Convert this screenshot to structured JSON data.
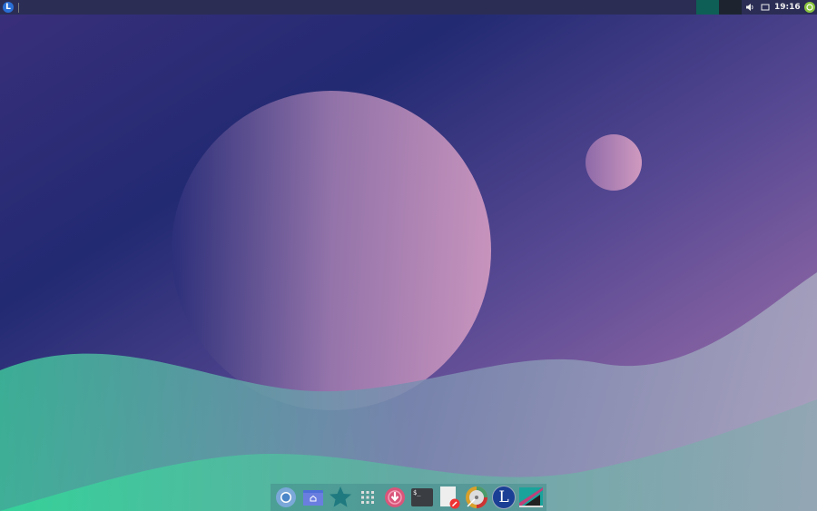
{
  "topbar": {
    "menu_letter": "L",
    "clock": "19:16",
    "workspaces": [
      "workspace-1",
      "workspace-2"
    ]
  },
  "dock": {
    "items": [
      {
        "name": "chromium",
        "icon": "browser-icon"
      },
      {
        "name": "home-folder",
        "icon": "folder-home-icon"
      },
      {
        "name": "favorites",
        "icon": "star-icon"
      },
      {
        "name": "app-grid",
        "icon": "grid-icon"
      },
      {
        "name": "updater",
        "icon": "download-icon"
      },
      {
        "name": "terminal",
        "icon": "terminal-icon",
        "label": "$_"
      },
      {
        "name": "text-editor",
        "icon": "text-editor-icon"
      },
      {
        "name": "disk-utility",
        "icon": "disk-icon"
      },
      {
        "name": "lubuntu-logo",
        "icon": "lubuntu-icon",
        "label": "L"
      },
      {
        "name": "screenshot",
        "icon": "screenshot-icon"
      }
    ]
  },
  "colors": {
    "accent": "#0e5f56",
    "panel": "#2b2d55",
    "dock_bg": "#468c8c"
  }
}
